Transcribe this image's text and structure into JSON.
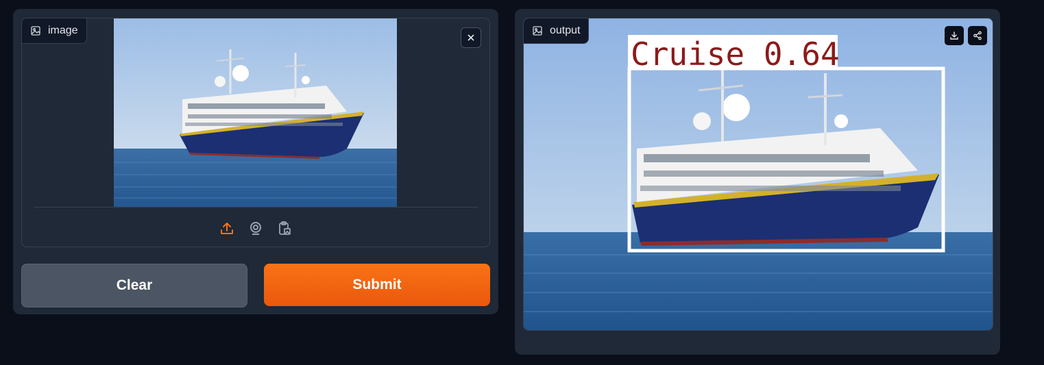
{
  "input": {
    "label": "image",
    "icon": "image-icon",
    "close_icon": "close-icon",
    "sources": [
      "upload-icon",
      "webcam-icon",
      "clipboard-icon"
    ]
  },
  "buttons": {
    "clear_label": "Clear",
    "submit_label": "Submit"
  },
  "output": {
    "label": "output",
    "icon": "image-icon",
    "detection_label": "Cruise 0.64",
    "tools": [
      "download-icon",
      "share-icon"
    ]
  },
  "colors": {
    "background": "#0b0f19",
    "panel": "#1f2937",
    "accent": "#f97316",
    "clear_button": "#4b5563",
    "detection_text": "#8b1a1a"
  }
}
